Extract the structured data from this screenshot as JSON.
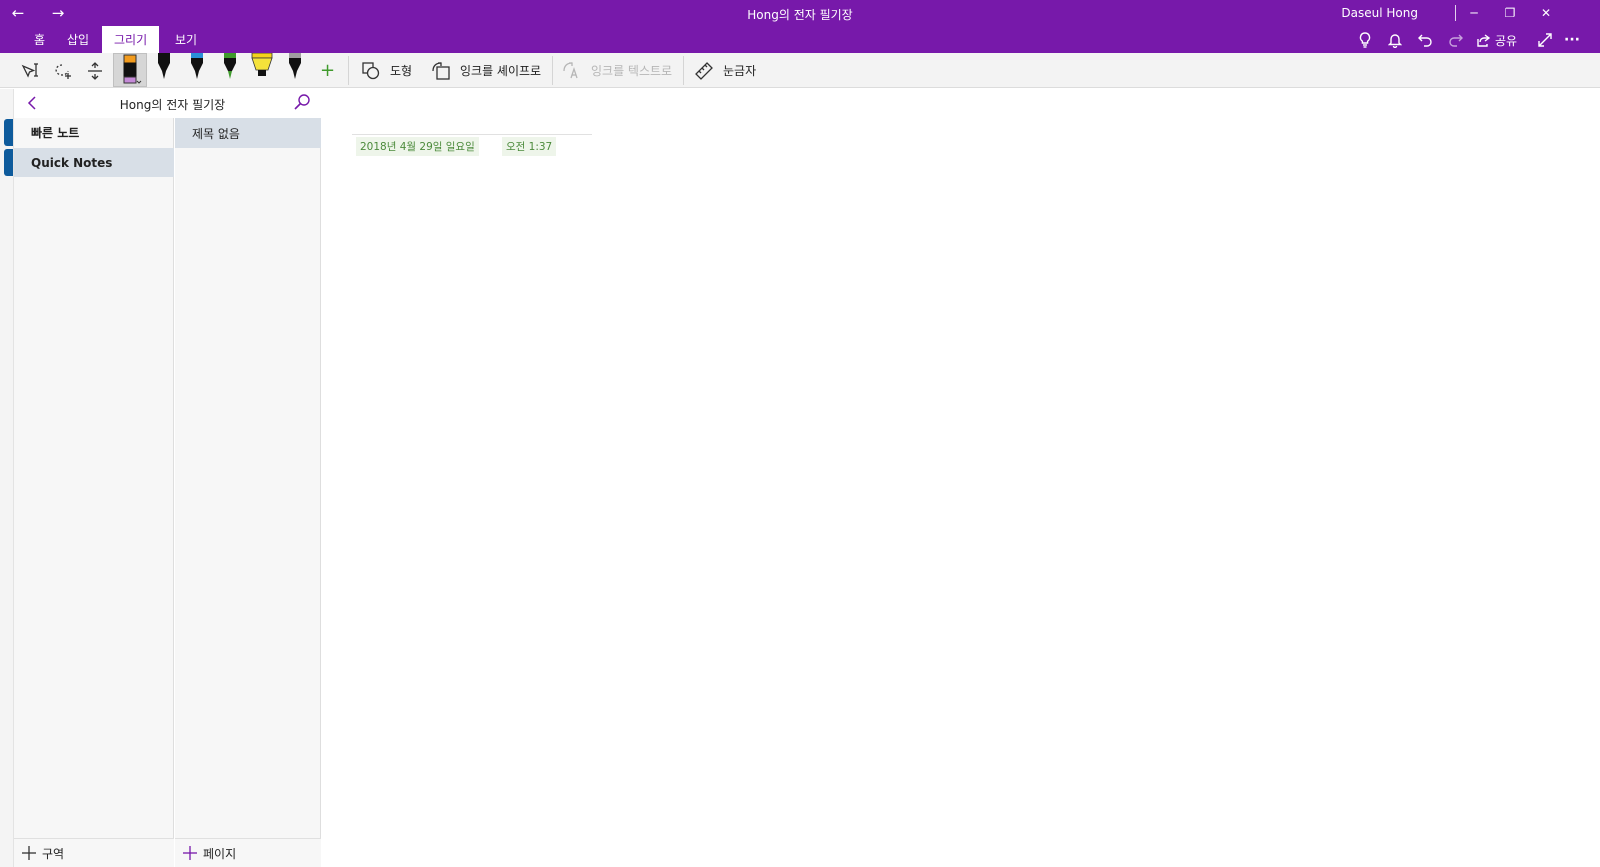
{
  "titlebar": {
    "title": "Hong의 전자 필기장",
    "user": "Daseul Hong",
    "back_icon": "←",
    "forward_icon": "→",
    "minimize_icon": "─",
    "restore_icon": "❐",
    "close_icon": "✕"
  },
  "ribbon": {
    "tabs": [
      {
        "label": "홈"
      },
      {
        "label": "삽입"
      },
      {
        "label": "그리기"
      },
      {
        "label": "보기"
      }
    ],
    "active_tab": "그리기",
    "share_label": "공유",
    "more_icon": "···"
  },
  "tools": {
    "shapes_label": "도형",
    "ink_to_shape_label": "잉크를 셰이프로",
    "ink_to_text_label": "잉크를 텍스트로",
    "ruler_label": "눈금자",
    "add_pen_icon": "+"
  },
  "colors": {
    "accent": "#7719aa",
    "section_blue": "#0e5b9c",
    "selected_bg": "#d8dfe7",
    "stamp_text": "#4b8a3b"
  },
  "notebook": {
    "title": "Hong의 전자 필기장",
    "sections": [
      {
        "label": "빠른 노트"
      },
      {
        "label": "Quick Notes"
      }
    ],
    "pages": [
      {
        "label": "제목 없음"
      }
    ],
    "add_section_label": "구역",
    "add_page_label": "페이지"
  },
  "page": {
    "date": "2018년 4월 29일 일요일",
    "time": "오전 1:37"
  }
}
